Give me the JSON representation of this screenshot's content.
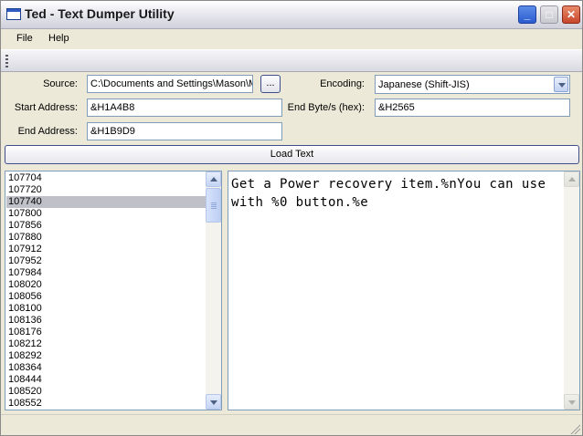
{
  "window": {
    "title": "Ted - Text Dumper Utility",
    "icon": "app-window-icon",
    "controls": [
      "minimize-icon",
      "maximize-icon",
      "close-icon"
    ]
  },
  "menu": {
    "file": "File",
    "help": "Help"
  },
  "form": {
    "source_label": "Source:",
    "source_value": "C:\\Documents and Settings\\Mason\\My Documents\\game.iso",
    "browse_label": "...",
    "encoding_label": "Encoding:",
    "encoding_value": "Japanese (Shift-JIS)",
    "start_label": "Start Address:",
    "start_value": "&H1A4B8",
    "end_bytes_label": "End Byte/s (hex):",
    "end_bytes_value": "&H2565",
    "end_label": "End Address:",
    "end_value": "&H1B9D9",
    "load_label": "Load Text"
  },
  "offsets": {
    "selected_index": 2,
    "items": [
      "107704",
      "107720",
      "107740",
      "107800",
      "107856",
      "107880",
      "107912",
      "107952",
      "107984",
      "108020",
      "108056",
      "108100",
      "108136",
      "108176",
      "108212",
      "108292",
      "108364",
      "108444",
      "108520",
      "108552"
    ]
  },
  "text_view": {
    "content": "Get a Power recovery item.%nYou can use with %0 button.%e"
  },
  "status": {
    "text": ""
  },
  "colors": {
    "selection": "#c0c0c8",
    "input_border": "#7f9db9",
    "face": "#ece9d8"
  }
}
